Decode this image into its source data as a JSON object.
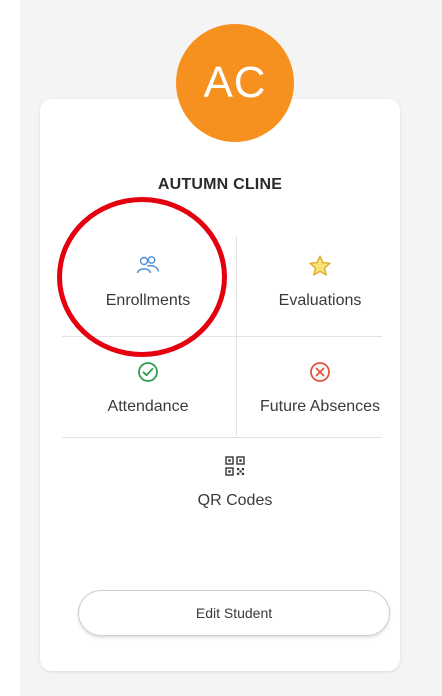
{
  "student": {
    "initials": "AC",
    "name": "AUTUMN CLINE"
  },
  "tiles": {
    "enrollments": {
      "label": "Enrollments",
      "icon": "people-icon"
    },
    "evaluations": {
      "label": "Evaluations",
      "icon": "star-icon"
    },
    "attendance": {
      "label": "Attendance",
      "icon": "check-circle-icon"
    },
    "future_absences": {
      "label": "Future Absences",
      "icon": "x-circle-icon"
    },
    "qr_codes": {
      "label": "QR Codes",
      "icon": "qr-code-icon"
    }
  },
  "actions": {
    "edit_student": "Edit Student"
  },
  "colors": {
    "avatar": "#f6901e",
    "enrollments_icon": "#4a90d9",
    "evaluations_icon": "#f2c22e",
    "attendance_icon": "#2e9e4f",
    "future_absences_icon": "#e5533d",
    "annotation": "#e4000f"
  }
}
